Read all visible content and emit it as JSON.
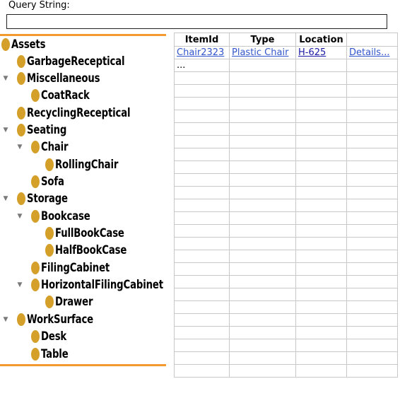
{
  "query": {
    "label": "Query String:",
    "value": "",
    "placeholder": ""
  },
  "tree": {
    "nodes": [
      {
        "label": "Assets"
      },
      {
        "label": "GarbageReceptical"
      },
      {
        "label": "Miscellaneous",
        "expanded": true
      },
      {
        "label": "CoatRack"
      },
      {
        "label": "RecyclingReceptical"
      },
      {
        "label": "Seating",
        "expanded": true
      },
      {
        "label": "Chair",
        "expanded": true
      },
      {
        "label": "RollingChair"
      },
      {
        "label": "Sofa"
      },
      {
        "label": "Storage",
        "expanded": true
      },
      {
        "label": "Bookcase",
        "expanded": true
      },
      {
        "label": "FullBookCase"
      },
      {
        "label": "HalfBookCase"
      },
      {
        "label": "FilingCabinet"
      },
      {
        "label": "HorizontalFilingCabinet",
        "expanded": true
      },
      {
        "label": "Drawer"
      },
      {
        "label": "WorkSurface",
        "expanded": true
      },
      {
        "label": "Desk"
      },
      {
        "label": "Table"
      }
    ]
  },
  "table": {
    "headers": [
      "ItemId",
      "Type",
      "Location",
      ""
    ],
    "rows": [
      [
        "Chair2323",
        "Plastic Chair",
        "H-625",
        "Details..."
      ],
      [
        "...",
        "",
        "",
        ""
      ]
    ]
  },
  "colors": {
    "accent": "#f29a2e",
    "node_dot": "#d4a02a",
    "link": "#3355cc"
  }
}
